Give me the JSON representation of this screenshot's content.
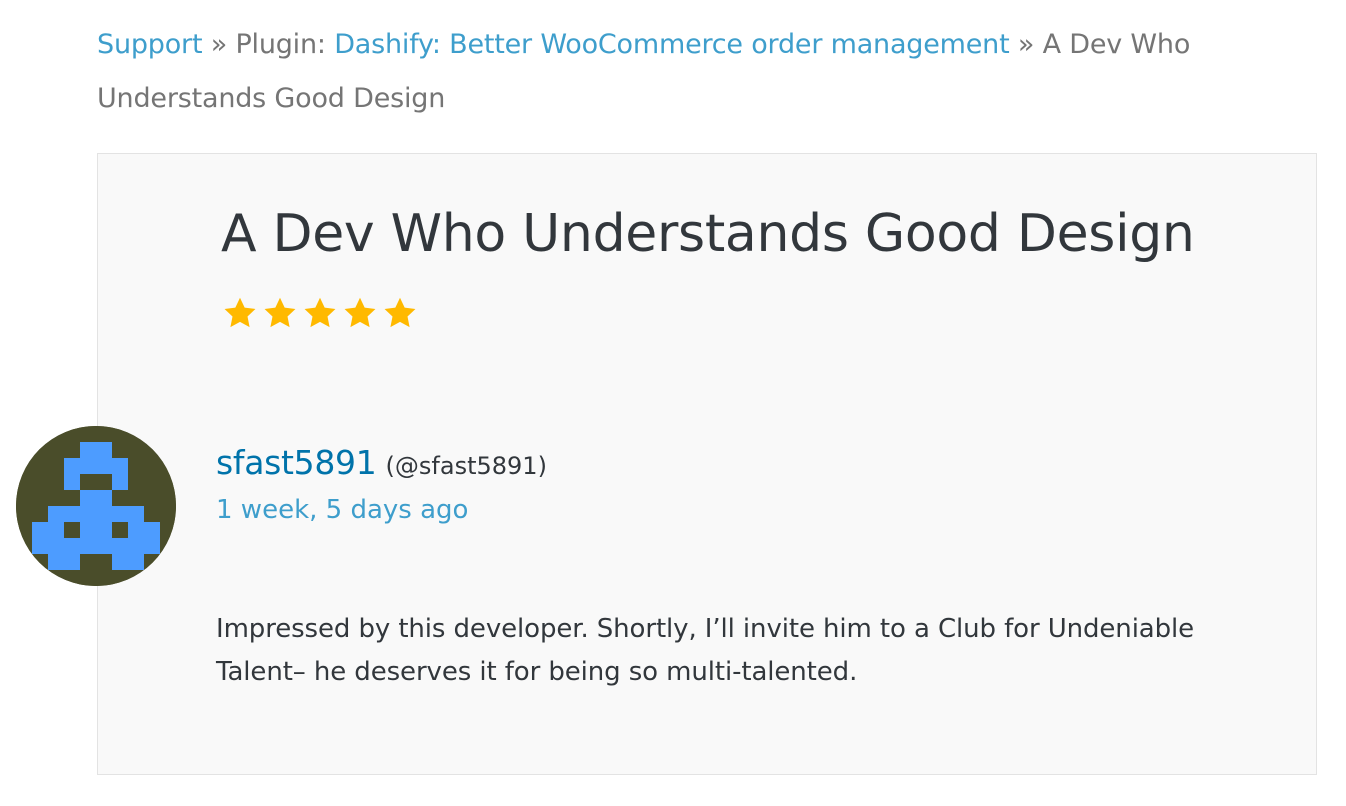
{
  "breadcrumb": {
    "support": "Support",
    "separator": "»",
    "plugin_prefix": "Plugin:",
    "plugin_name": "Dashify: Better WooCommerce order management",
    "current": "A Dev Who Understands Good Design"
  },
  "review": {
    "title": "A Dev Who Understands Good Design",
    "rating": 5,
    "rating_max": 5,
    "star_icon": "star-filled-icon",
    "author": {
      "name": "sfast5891",
      "handle": "(@sfast5891)",
      "avatar_icon": "identicon-avatar"
    },
    "date": "1 week, 5 days ago",
    "body": "Impressed by this developer. Shortly, I’ll invite him to a Club for Undeniable Talent– he deserves it for being so multi-talented."
  },
  "colors": {
    "link": "#3e9ecc",
    "author_link": "#0073aa",
    "text": "#32373c",
    "muted": "#757575",
    "star": "#ffb900",
    "card_bg": "#f9f9f9",
    "avatar_bg": "#4a4d2a",
    "avatar_fg": "#4d9cff"
  }
}
